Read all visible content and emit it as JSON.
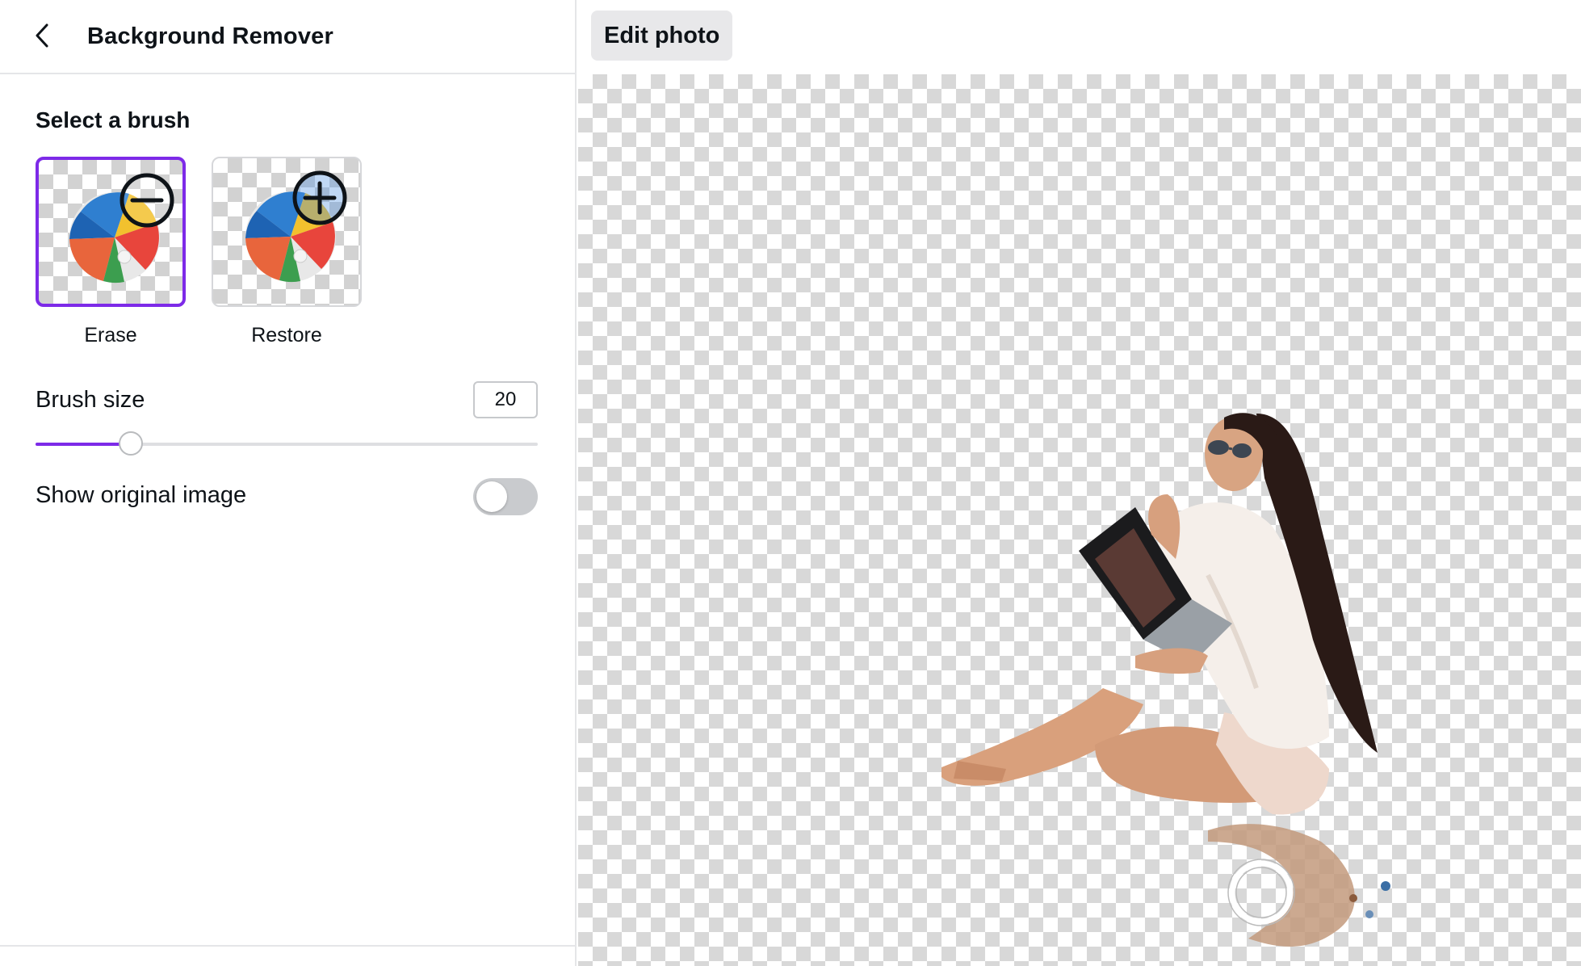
{
  "header": {
    "title": "Background Remover",
    "back_icon": "chevron-left-icon"
  },
  "brush_section": {
    "heading": "Select a brush",
    "options": [
      {
        "label": "Erase",
        "icon": "minus-circle-icon",
        "selected": true
      },
      {
        "label": "Restore",
        "icon": "plus-circle-icon",
        "selected": false
      }
    ]
  },
  "brush_size": {
    "label": "Brush size",
    "value": "20",
    "slider_fraction": 0.19
  },
  "show_original": {
    "label": "Show original image",
    "enabled": false
  },
  "toolbar": {
    "edit_photo_label": "Edit photo"
  },
  "colors": {
    "accent": "#7d2ae8",
    "toggle_off": "#c9cbce",
    "checker": "#d8d8d8"
  }
}
